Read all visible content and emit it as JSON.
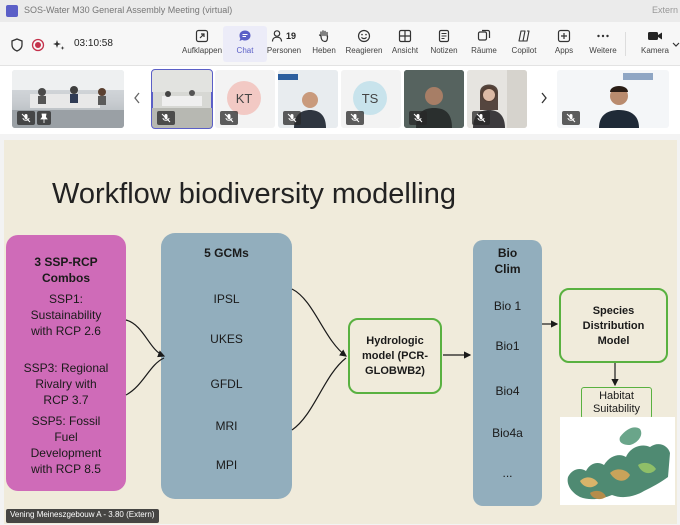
{
  "window": {
    "title": "SOS-Water M30 General Assembly Meeting (virtual)",
    "extern_label": "Extern"
  },
  "toolbar": {
    "timer": "03:10:58",
    "tools": [
      {
        "label": "Aufklappen",
        "icon": "expand-icon"
      },
      {
        "label": "Chat",
        "icon": "chat-icon"
      },
      {
        "label": "Personen",
        "icon": "people-icon",
        "count": "19"
      },
      {
        "label": "Heben",
        "icon": "raise-hand-icon"
      },
      {
        "label": "Reagieren",
        "icon": "react-icon"
      },
      {
        "label": "Ansicht",
        "icon": "view-icon"
      },
      {
        "label": "Notizen",
        "icon": "notes-icon"
      },
      {
        "label": "Räume",
        "icon": "rooms-icon"
      },
      {
        "label": "Copilot",
        "icon": "copilot-icon"
      },
      {
        "label": "Apps",
        "icon": "apps-icon"
      },
      {
        "label": "Weitere",
        "icon": "more-icon"
      },
      {
        "label": "Kamera",
        "icon": "camera-icon"
      }
    ],
    "active_tool": "Chat"
  },
  "participants": {
    "initials": [
      "KT",
      "TS"
    ]
  },
  "slide": {
    "title": "Workflow biodiversity modelling",
    "scenarios": {
      "heading": [
        "3 SSP-RCP",
        "Combos"
      ],
      "items": [
        [
          "SSP1:",
          "Sustainability",
          "with RCP 2.6"
        ],
        [
          "SSP3: Regional",
          "Rivalry with",
          "RCP 3.7"
        ],
        [
          "SSP5: Fossil",
          "Fuel",
          "Development",
          "with RCP 8.5"
        ]
      ]
    },
    "gcms": {
      "heading": "5 GCMs",
      "items": [
        "IPSL",
        "UKES",
        "GFDL",
        "MRI",
        "MPI"
      ]
    },
    "hydro_model": [
      "Hydrologic",
      "model (PCR-",
      "GLOBWB2)"
    ],
    "bioclim": {
      "heading": [
        "Bio",
        "Clim"
      ],
      "items": [
        "Bio 1",
        "Bio1",
        "Bio4",
        "Bio4a",
        "..."
      ]
    },
    "sdm": [
      "Species",
      "Distribution",
      "Model"
    ],
    "habitat": [
      "Habitat",
      "Suitability"
    ]
  },
  "speaker_caption": "Vening Meineszgebouw A - 3.80 (Extern)",
  "colors": {
    "accent": "#5b5fc7",
    "slide_bg": "#f0ebdb",
    "pink_box": "#cf6bb8",
    "blue_box": "#92aebd",
    "green_border": "#59b140"
  }
}
